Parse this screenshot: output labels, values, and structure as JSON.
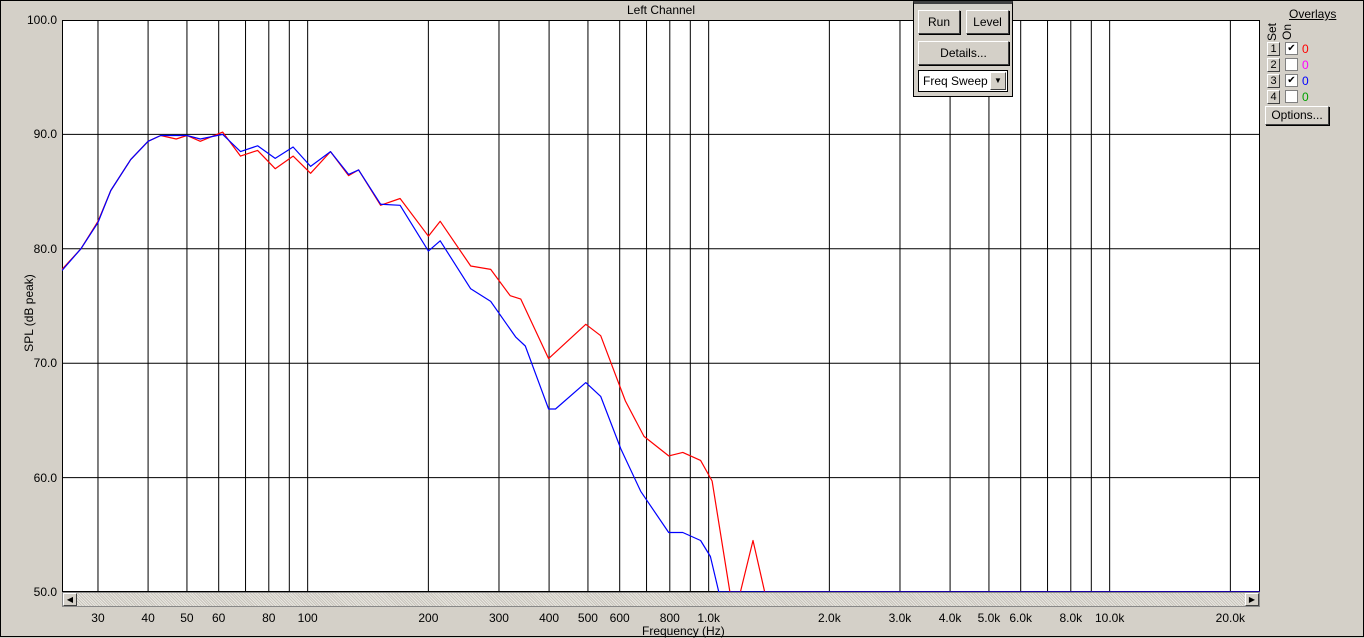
{
  "title": "Left Channel",
  "y_axis": {
    "label": "SPL (dB peak)",
    "ticks": [
      "100.0",
      "90.0",
      "80.0",
      "70.0",
      "60.0",
      "50.0"
    ]
  },
  "x_axis": {
    "label": "Frequency (Hz)",
    "ticks": [
      "30",
      "40",
      "50",
      "60",
      "80",
      "100",
      "200",
      "300",
      "400",
      "500",
      "600",
      "800",
      "1.0k",
      "2.0k",
      "3.0k",
      "4.0k",
      "5.0k",
      "6.0k",
      "8.0k",
      "10.0k",
      "20.0k"
    ]
  },
  "controls": {
    "run": "Run",
    "level": "Level",
    "details": "Details...",
    "mode": "Freq Sweep"
  },
  "overlays": {
    "title": "Overlays",
    "set_header": "Set",
    "on_header": "On",
    "options": "Options...",
    "items": [
      {
        "set": "1",
        "on": true,
        "count": "0",
        "color": "#ff0000"
      },
      {
        "set": "2",
        "on": false,
        "count": "0",
        "color": "#ff00ff"
      },
      {
        "set": "3",
        "on": true,
        "count": "0",
        "color": "#0000ff"
      },
      {
        "set": "4",
        "on": false,
        "count": "0",
        "color": "#00a000"
      }
    ]
  },
  "chart_data": {
    "type": "line",
    "title": "Left Channel",
    "xlabel": "Frequency (Hz)",
    "ylabel": "SPL (dB peak)",
    "xscale": "log",
    "xlim": [
      24.4,
      23700
    ],
    "ylim": [
      50,
      100
    ],
    "grid": true,
    "series": [
      {
        "color": "#ff0000",
        "points": [
          [
            24.4,
            78.2
          ],
          [
            27.2,
            80.0
          ],
          [
            30,
            82.4
          ],
          [
            32.3,
            85.1
          ],
          [
            36.2,
            87.8
          ],
          [
            40,
            89.4
          ],
          [
            43,
            89.9
          ],
          [
            47,
            89.6
          ],
          [
            50,
            89.9
          ],
          [
            54,
            89.4
          ],
          [
            61.4,
            90.2
          ],
          [
            68,
            88.1
          ],
          [
            75,
            88.6
          ],
          [
            83,
            87.0
          ],
          [
            92,
            88.1
          ],
          [
            101.7,
            86.6
          ],
          [
            114,
            88.5
          ],
          [
            126.5,
            86.4
          ],
          [
            134,
            86.9
          ],
          [
            152,
            83.8
          ],
          [
            170,
            84.4
          ],
          [
            200,
            81.1
          ],
          [
            214,
            82.4
          ],
          [
            255,
            78.5
          ],
          [
            286,
            78.2
          ],
          [
            320,
            75.9
          ],
          [
            340,
            75.6
          ],
          [
            399,
            70.4
          ],
          [
            494,
            73.4
          ],
          [
            538,
            72.4
          ],
          [
            620,
            66.7
          ],
          [
            690,
            63.6
          ],
          [
            795,
            61.9
          ],
          [
            862,
            62.2
          ],
          [
            955,
            61.5
          ],
          [
            1020,
            59.7
          ],
          [
            1130,
            50
          ],
          [
            1200,
            50
          ],
          [
            1290,
            54.5
          ],
          [
            1380,
            50
          ],
          [
            23700,
            50
          ]
        ]
      },
      {
        "color": "#0000ff",
        "points": [
          [
            24.4,
            78.1
          ],
          [
            27.2,
            80.0
          ],
          [
            30,
            82.3
          ],
          [
            32.3,
            85.1
          ],
          [
            36.2,
            87.8
          ],
          [
            40,
            89.4
          ],
          [
            43,
            89.9
          ],
          [
            50,
            89.9
          ],
          [
            54,
            89.6
          ],
          [
            61.4,
            90.0
          ],
          [
            68,
            88.5
          ],
          [
            75,
            89.0
          ],
          [
            83,
            87.9
          ],
          [
            92,
            88.9
          ],
          [
            101.7,
            87.2
          ],
          [
            114,
            88.5
          ],
          [
            126.5,
            86.5
          ],
          [
            134,
            86.9
          ],
          [
            152,
            83.9
          ],
          [
            170,
            83.8
          ],
          [
            200,
            79.8
          ],
          [
            214,
            80.7
          ],
          [
            255,
            76.5
          ],
          [
            286,
            75.4
          ],
          [
            330,
            72.3
          ],
          [
            349,
            71.5
          ],
          [
            399,
            66.0
          ],
          [
            415,
            66.0
          ],
          [
            494,
            68.3
          ],
          [
            538,
            67.1
          ],
          [
            604,
            62.5
          ],
          [
            677,
            58.8
          ],
          [
            795,
            55.2
          ],
          [
            862,
            55.2
          ],
          [
            955,
            54.5
          ],
          [
            1010,
            53.1
          ],
          [
            1060,
            50
          ],
          [
            23700,
            50
          ]
        ]
      }
    ]
  }
}
